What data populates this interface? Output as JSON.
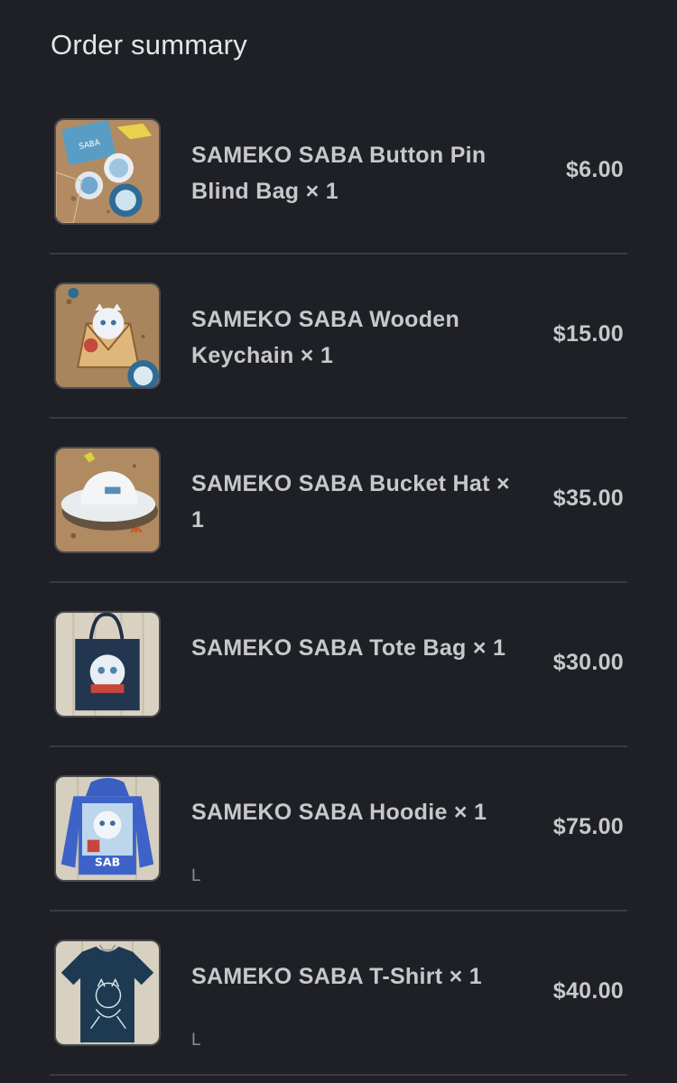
{
  "order_summary": {
    "title": "Order summary",
    "items": [
      {
        "name": "SAMEKO SABA Button Pin Blind Bag × 1",
        "variant": "",
        "price": "$6.00",
        "image": "button-pin-blind-bag"
      },
      {
        "name": "SAMEKO SABA Wooden Keychain × 1",
        "variant": "",
        "price": "$15.00",
        "image": "wooden-keychain"
      },
      {
        "name": "SAMEKO SABA Bucket Hat × 1",
        "variant": "",
        "price": "$35.00",
        "image": "bucket-hat"
      },
      {
        "name": "SAMEKO SABA Tote Bag × 1",
        "variant": "",
        "price": "$30.00",
        "image": "tote-bag"
      },
      {
        "name": "SAMEKO SABA Hoodie × 1",
        "variant": "L",
        "price": "$75.00",
        "image": "hoodie"
      },
      {
        "name": "SAMEKO SABA T-Shirt × 1",
        "variant": "L",
        "price": "$40.00",
        "image": "t-shirt"
      }
    ]
  },
  "colors": {
    "background": "#1f2025",
    "divider": "#3a3b40",
    "text": "#c7c8cc",
    "muted": "#8b8c91"
  }
}
